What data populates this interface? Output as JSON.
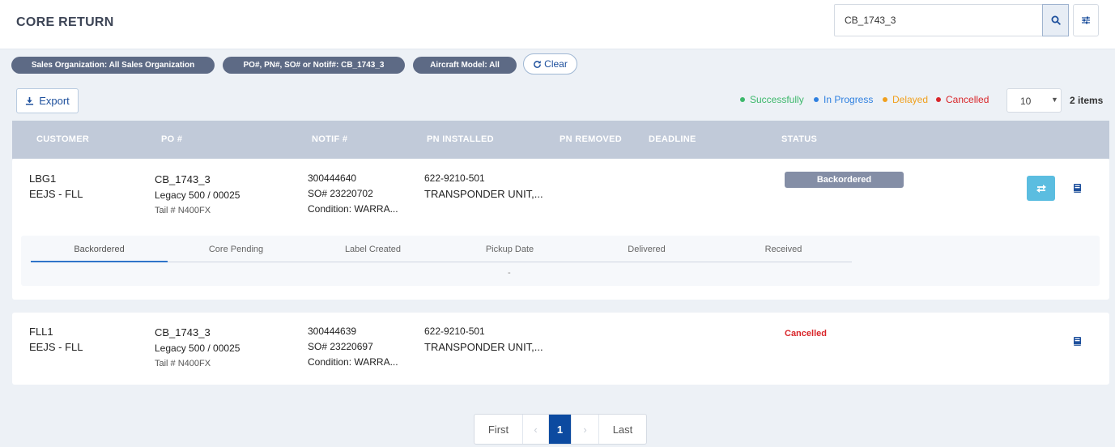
{
  "header": {
    "title": "CORE RETURN",
    "search_value": "CB_1743_3"
  },
  "filters": {
    "chips": [
      "Sales Organization: All Sales Organization",
      "PO#, PN#, SO# or Notif#: CB_1743_3",
      "Aircraft Model: All"
    ],
    "clear_label": "Clear"
  },
  "toolbar": {
    "export_label": "Export",
    "legend": [
      {
        "label": "Successfully",
        "color": "#3db86b"
      },
      {
        "label": "In Progress",
        "color": "#2f80e0"
      },
      {
        "label": "Delayed",
        "color": "#f0a01e"
      },
      {
        "label": "Cancelled",
        "color": "#d9262a"
      }
    ],
    "page_size": "10",
    "items_count": "2 items"
  },
  "table": {
    "columns": [
      "CUSTOMER",
      "PO #",
      "NOTIF #",
      "PN INSTALLED",
      "PN REMOVED",
      "DEADLINE",
      "STATUS"
    ],
    "rows": [
      {
        "customer": "LBG1",
        "location": "EEJS - FLL",
        "po": "CB_1743_3",
        "model": "Legacy 500 / 00025",
        "tail": "Tail # N400FX",
        "notif": "300444640",
        "so": "SO# 23220702",
        "condition": "Condition: WARRA...",
        "pn_installed": "622-9210-501",
        "pn_desc": "TRANSPONDER UNIT,...",
        "status": "Backordered",
        "tracker": {
          "steps": [
            "Backordered",
            "Core Pending",
            "Label Created",
            "Pickup Date",
            "Delivered",
            "Received"
          ],
          "active_index": 0,
          "detail": "-"
        }
      },
      {
        "customer": "FLL1",
        "location": "EEJS - FLL",
        "po": "CB_1743_3",
        "model": "Legacy 500 / 00025",
        "tail": "Tail # N400FX",
        "notif": "300444639",
        "so": "SO# 23220697",
        "condition": "Condition: WARRA...",
        "pn_installed": "622-9210-501",
        "pn_desc": "TRANSPONDER UNIT,...",
        "status": "Cancelled"
      }
    ]
  },
  "pagination": {
    "first": "First",
    "prev": "‹",
    "current": "1",
    "next": "›",
    "last": "Last"
  }
}
